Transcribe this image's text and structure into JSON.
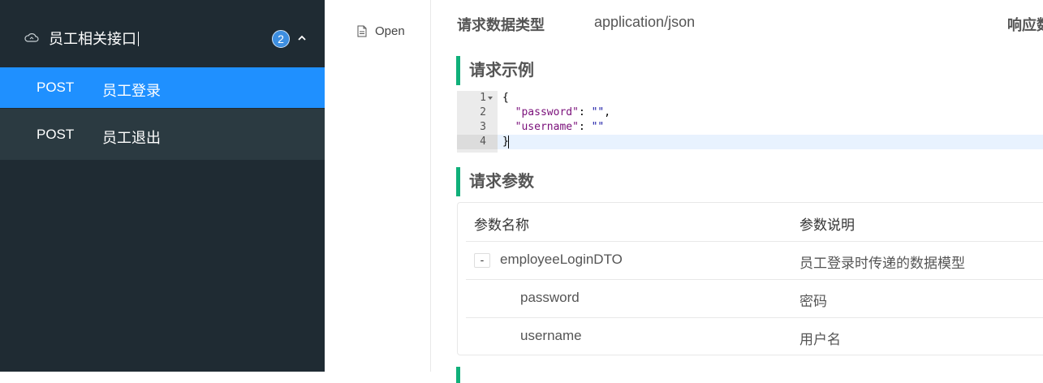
{
  "sidebar": {
    "group": {
      "title": "员工相关接口",
      "count": "2"
    },
    "items": [
      {
        "method": "POST",
        "name": "员工登录"
      },
      {
        "method": "POST",
        "name": "员工退出"
      }
    ]
  },
  "toolbar": {
    "open_label": "Open"
  },
  "main": {
    "request_type_label": "请求数据类型",
    "request_type_value": "application/json",
    "response_type_label": "响应数",
    "example_title": "请求示例",
    "params_title": "请求参数",
    "code": {
      "line_numbers": [
        "1",
        "2",
        "3",
        "4"
      ],
      "open_brace": "{",
      "close_brace": "}",
      "key1": "\"password\"",
      "key2": "\"username\"",
      "val1": "\"\"",
      "val2": "\"\"",
      "colon": ": ",
      "comma": ","
    },
    "params_table": {
      "headers": [
        "参数名称",
        "参数说明"
      ],
      "rows": [
        {
          "name": "employeeLoginDTO",
          "desc": "员工登录时传递的数据模型",
          "toggle": "-"
        },
        {
          "name": "password",
          "desc": "密码"
        },
        {
          "name": "username",
          "desc": "用户名"
        }
      ]
    }
  },
  "colors": {
    "accent": "#1f90ff",
    "section_bar": "#10b07a",
    "sidebar_bg": "#1f2b33"
  }
}
